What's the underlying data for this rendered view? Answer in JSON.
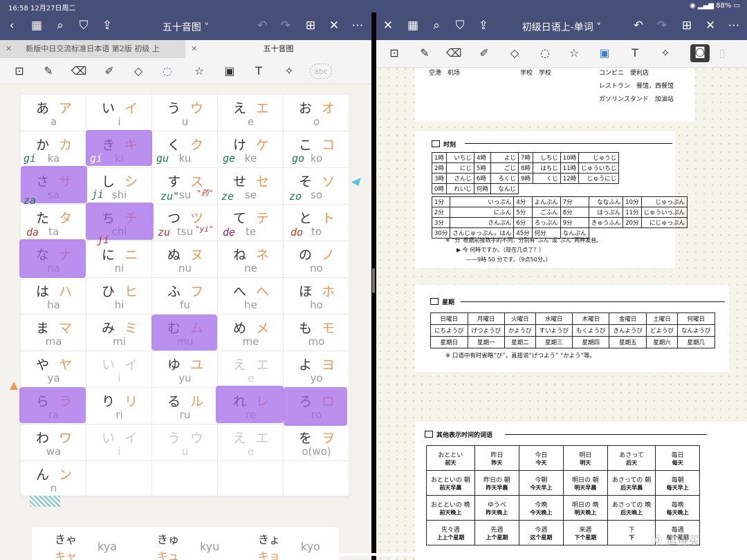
{
  "status": {
    "time": "16:58",
    "date": "12月27日周二",
    "battery": "88%"
  },
  "left": {
    "title": "五十音图",
    "tabs": [
      "新版中日交流标准日本语 第2版 初级 上",
      "五十音图"
    ],
    "kana_rows": [
      [
        [
          "あ",
          "ア",
          "a"
        ],
        [
          "い",
          "イ",
          "i"
        ],
        [
          "う",
          "ウ",
          "u"
        ],
        [
          "え",
          "エ",
          "e"
        ],
        [
          "お",
          "オ",
          "o"
        ]
      ],
      [
        [
          "か",
          "カ",
          "ka"
        ],
        [
          "き",
          "キ",
          "ki"
        ],
        [
          "く",
          "ク",
          "ku"
        ],
        [
          "け",
          "ケ",
          "ke"
        ],
        [
          "こ",
          "コ",
          "ko"
        ]
      ],
      [
        [
          "さ",
          "サ",
          "sa"
        ],
        [
          "し",
          "シ",
          "shi"
        ],
        [
          "す",
          "ス",
          "su"
        ],
        [
          "せ",
          "セ",
          "se"
        ],
        [
          "そ",
          "ソ",
          "so"
        ]
      ],
      [
        [
          "た",
          "タ",
          "ta"
        ],
        [
          "ち",
          "チ",
          "chi"
        ],
        [
          "つ",
          "ツ",
          "tsu"
        ],
        [
          "て",
          "テ",
          "te"
        ],
        [
          "と",
          "ト",
          "to"
        ]
      ],
      [
        [
          "な",
          "ナ",
          "na"
        ],
        [
          "に",
          "ニ",
          "ni"
        ],
        [
          "ぬ",
          "ヌ",
          "nu"
        ],
        [
          "ね",
          "ネ",
          "ne"
        ],
        [
          "の",
          "ノ",
          "no"
        ]
      ],
      [
        [
          "は",
          "ハ",
          "ha"
        ],
        [
          "ひ",
          "ヒ",
          "hi"
        ],
        [
          "ふ",
          "フ",
          "fu"
        ],
        [
          "へ",
          "ヘ",
          "he"
        ],
        [
          "ほ",
          "ホ",
          "ho"
        ]
      ],
      [
        [
          "ま",
          "マ",
          "ma"
        ],
        [
          "み",
          "ミ",
          "mi"
        ],
        [
          "む",
          "ム",
          "mu"
        ],
        [
          "め",
          "メ",
          "me"
        ],
        [
          "も",
          "モ",
          "mo"
        ]
      ],
      [
        [
          "や",
          "ヤ",
          "ya"
        ],
        [
          "い",
          "イ",
          "i"
        ],
        [
          "ゆ",
          "ユ",
          "yu"
        ],
        [
          "え",
          "エ",
          "e"
        ],
        [
          "よ",
          "ヨ",
          "yo"
        ]
      ],
      [
        [
          "ら",
          "ラ",
          "ra"
        ],
        [
          "り",
          "リ",
          "ri"
        ],
        [
          "る",
          "ル",
          "ru"
        ],
        [
          "れ",
          "レ",
          "re"
        ],
        [
          "ろ",
          "ロ",
          "ro"
        ]
      ],
      [
        [
          "わ",
          "ワ",
          "wa"
        ],
        [
          "い",
          "イ",
          "i"
        ],
        [
          "う",
          "ウ",
          "u"
        ],
        [
          "え",
          "エ",
          "e"
        ],
        [
          "を",
          "ヲ",
          "o(wo)"
        ]
      ],
      [
        [
          "ん",
          "ン",
          "n"
        ],
        [
          "",
          "",
          ""
        ],
        [
          "",
          "",
          ""
        ],
        [
          "",
          "",
          ""
        ],
        [
          "",
          "",
          ""
        ]
      ]
    ],
    "notes": {
      "gi": "gi",
      "gi2": "gi",
      "gu": "gu",
      "ge": "ge",
      "go": "go",
      "za": "za",
      "ji": "ji",
      "zu": "zu\"",
      "zu_mark": "\"药\"",
      "ze": "ze",
      "zo": "zo",
      "da": "da",
      "ji2": "ji",
      "zu2": "zu",
      "zu2_mark": "\"yi\"",
      "de": "de",
      "do": "do"
    },
    "youon": [
      [
        "きゃ",
        "キャ",
        "kya"
      ],
      [
        "きゅ",
        "キュ",
        "kyu"
      ],
      [
        "きょ",
        "キョ",
        "kyo"
      ]
    ]
  },
  "right": {
    "title": "初级日语上-单词",
    "top_words": [
      [
        "空港",
        "机场"
      ],
      [
        "学校",
        "学校"
      ],
      [
        "コンビニ",
        "便利店"
      ],
      [
        "レストラン",
        "餐馆，西餐馆"
      ],
      [
        "ガソリンスタンド",
        "加油站"
      ]
    ],
    "jikoku": {
      "heading": "时刻",
      "hours": [
        [
          "1時",
          "いちじ"
        ],
        [
          "2時",
          "にじ"
        ],
        [
          "3時",
          "さんじ"
        ],
        [
          "0時",
          "れいじ"
        ],
        [
          "4時",
          "よじ"
        ],
        [
          "5時",
          "ごじ"
        ],
        [
          "6時",
          "ろくじ"
        ],
        [
          "何時",
          "なんじ"
        ],
        [
          "7時",
          "しちじ"
        ],
        [
          "8時",
          "はちじ"
        ],
        [
          "9時",
          "くじ"
        ],
        [
          "10時",
          "じゅうじ"
        ],
        [
          "11時",
          "じゅういちじ"
        ],
        [
          "12時",
          "じゅうにじ"
        ]
      ],
      "minutes": [
        [
          "1分",
          "いっぷん"
        ],
        [
          "2分",
          "にふん"
        ],
        [
          "3分",
          "さんぷん"
        ],
        [
          "30分",
          "さんじゅっぷん，はん"
        ],
        [
          "4分",
          "よんぷん"
        ],
        [
          "5分",
          "ごふん"
        ],
        [
          "6分",
          "ろっぷん"
        ],
        [
          "45分",
          "よんじゅうごふん"
        ],
        [
          "7分",
          "ななふん"
        ],
        [
          "8分",
          "はっぷん"
        ],
        [
          "9分",
          "きゅうふん"
        ],
        [
          "10分",
          "じゅっぷん"
        ],
        [
          "11分",
          "じゅういっぷん"
        ],
        [
          "20分",
          "にじゅっぷん"
        ],
        [
          "何分",
          "なんぷん"
        ]
      ],
      "note1": "※ “分”根据前接数字的不同，分别有“ふん”或“ぷん”两种发音。",
      "note2": "▶ 今 何時ですか。（现在几点了？）",
      "note3": "——9時 50 分です。（9点50分。）"
    },
    "youbi": {
      "heading": "星期",
      "jp": [
        "日曜日",
        "月曜日",
        "火曜日",
        "水曜日",
        "木曜日",
        "金曜日",
        "土曜日",
        "何曜日"
      ],
      "kana": [
        "にちようび",
        "げつようび",
        "かようび",
        "すいようび",
        "もくようび",
        "きんようび",
        "どようび",
        "なんようび"
      ],
      "zh": [
        "星期日",
        "星期一",
        "星期二",
        "星期三",
        "星期四",
        "星期五",
        "星期六",
        "星期几"
      ],
      "note": "※ 口语中有时省略“び”，直接说“げつよう” “かよう”等。"
    },
    "jikan": {
      "heading": "其他表示时间的词语",
      "rows": [
        [
          [
            "おととい",
            "前天"
          ],
          [
            "昨日",
            "昨天"
          ],
          [
            "今日",
            "今天"
          ],
          [
            "明日",
            "明天"
          ],
          [
            "あさって",
            "后天"
          ],
          [
            "毎日",
            "每天"
          ]
        ],
        [
          [
            "おとといの 朝",
            "前天早晨"
          ],
          [
            "昨日の 朝",
            "昨天早晨"
          ],
          [
            "今朝",
            "今天早上"
          ],
          [
            "明日の 朝",
            "明天早晨"
          ],
          [
            "あさっての 朝",
            "后天早晨"
          ],
          [
            "毎朝",
            "每天早上"
          ]
        ],
        [
          [
            "おとといの 晩",
            "前天晚上"
          ],
          [
            "ゆうべ",
            "昨天晚上"
          ],
          [
            "今晩",
            "今天晚上"
          ],
          [
            "明日の 晩",
            "明天晚上"
          ],
          [
            "あさっての 晩",
            "后天晚上"
          ],
          [
            "毎晩",
            "每天晚上"
          ]
        ],
        [
          [
            "先々週",
            "上上个星期"
          ],
          [
            "先週",
            "上个星期"
          ],
          [
            "今週",
            "这个星期"
          ],
          [
            "来週",
            "下个星期"
          ],
          [
            "下",
            "下"
          ],
          [
            "毎週",
            "每个星期"
          ]
        ]
      ]
    },
    "watermark": "值得买"
  },
  "colors": {
    "nav": "#454f78",
    "highlight": "#a064e6",
    "kana_orange": "#e89a5b"
  }
}
